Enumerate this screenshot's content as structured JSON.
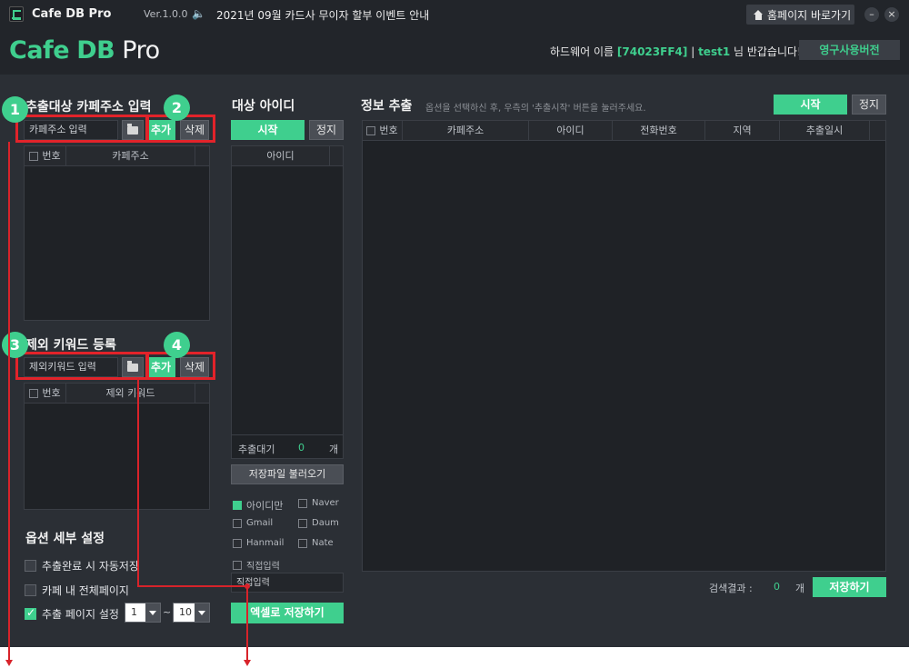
{
  "titlebar": {
    "app_name": "Cafe DB Pro",
    "version": "Ver.1.0.0",
    "notice": "2021년 09월 카드사 무이자 할부 이벤트 안내",
    "home_button": "홈페이지 바로가기",
    "minimize": "–",
    "close": "×"
  },
  "brand": {
    "cafe": "Cafe",
    "db": "DB",
    "pro": "Pro"
  },
  "hardware": {
    "label": "하드웨어 이름",
    "id": "[74023FF4]",
    "sep": "|",
    "user": "test1",
    "greeting": "님 반갑습니다!"
  },
  "license_button": "영구사용버전",
  "url_section": {
    "title": "추출대상 카페주소 입력",
    "input_placeholder": "카페주소 입력",
    "add": "추가",
    "delete": "삭제",
    "columns": [
      "번호",
      "카페주소"
    ]
  },
  "keyword_section": {
    "title": "제외 키워드 등록",
    "input_placeholder": "제외키워드 입력",
    "add": "추가",
    "delete": "삭제",
    "columns": [
      "번호",
      "제외 키워드"
    ]
  },
  "options": {
    "title": "옵션 세부 설정",
    "auto_save": "추출완료 시 자동저장",
    "all_pages": "카페 내 전체페이지",
    "page_setting": "추출 페이지 설정",
    "page_from": "1",
    "tilde": "~",
    "page_to": "10"
  },
  "target_ids": {
    "title": "대상 아이디",
    "start": "시작",
    "stop": "정지",
    "column": "아이디",
    "waiting_label": "추출대기",
    "waiting_count": "0",
    "unit": "개",
    "load_button": "저장파일 불러오기",
    "opt_id_only": "아이디만",
    "opt_naver": "Naver",
    "opt_gmail": "Gmail",
    "opt_daum": "Daum",
    "opt_hanmail": "Hanmail",
    "opt_nate": "Nate",
    "opt_direct": "직접입력",
    "direct_placeholder": "직접입력",
    "excel_button": "엑셀로 저장하기"
  },
  "extract": {
    "title": "정보 추출",
    "hint": "옵션을 선택하신 후, 우측의 '추출시작' 버튼을 눌러주세요.",
    "start": "시작",
    "stop": "정지",
    "columns": [
      "번호",
      "카페주소",
      "아이디",
      "전화번호",
      "지역",
      "추출일시"
    ],
    "result_label": "검색결과 :",
    "result_count": "0",
    "unit": "개",
    "save_button": "저장하기"
  },
  "annotations": [
    "1",
    "2",
    "3",
    "4"
  ],
  "colors": {
    "accent": "#3fcf8e",
    "annotation": "#e2232a",
    "background": "#2b2f35"
  }
}
